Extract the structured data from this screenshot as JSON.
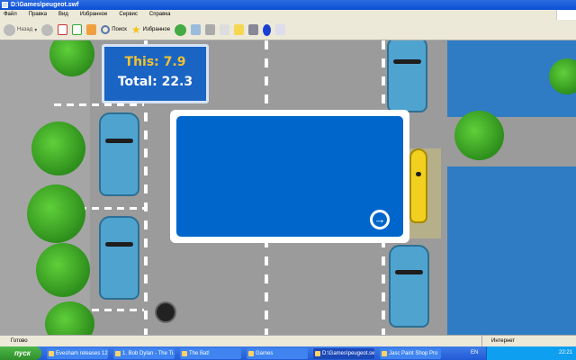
{
  "window": {
    "title": "D:\\Games\\peugeot.swf"
  },
  "menu": [
    "Файл",
    "Правка",
    "Вид",
    "Избранное",
    "Сервис",
    "Справка"
  ],
  "toolbar": {
    "back": "Назад",
    "search": "Поиск",
    "favorites": "Избранное"
  },
  "game": {
    "score_this": "This: 7.9",
    "score_total": "Total: 22.3"
  },
  "status": {
    "left": "Готово",
    "zone": "Интернет"
  },
  "taskbar": {
    "start": "пуск",
    "tasks": [
      "Evesham releases 12...",
      "1. Bob Dylan - The Ti...",
      "The Bat!",
      "Games",
      "D:\\Games\\peugeot.swf",
      "Jasc Paint Shop Pro"
    ],
    "lang": "EN",
    "clock": "22:21"
  }
}
